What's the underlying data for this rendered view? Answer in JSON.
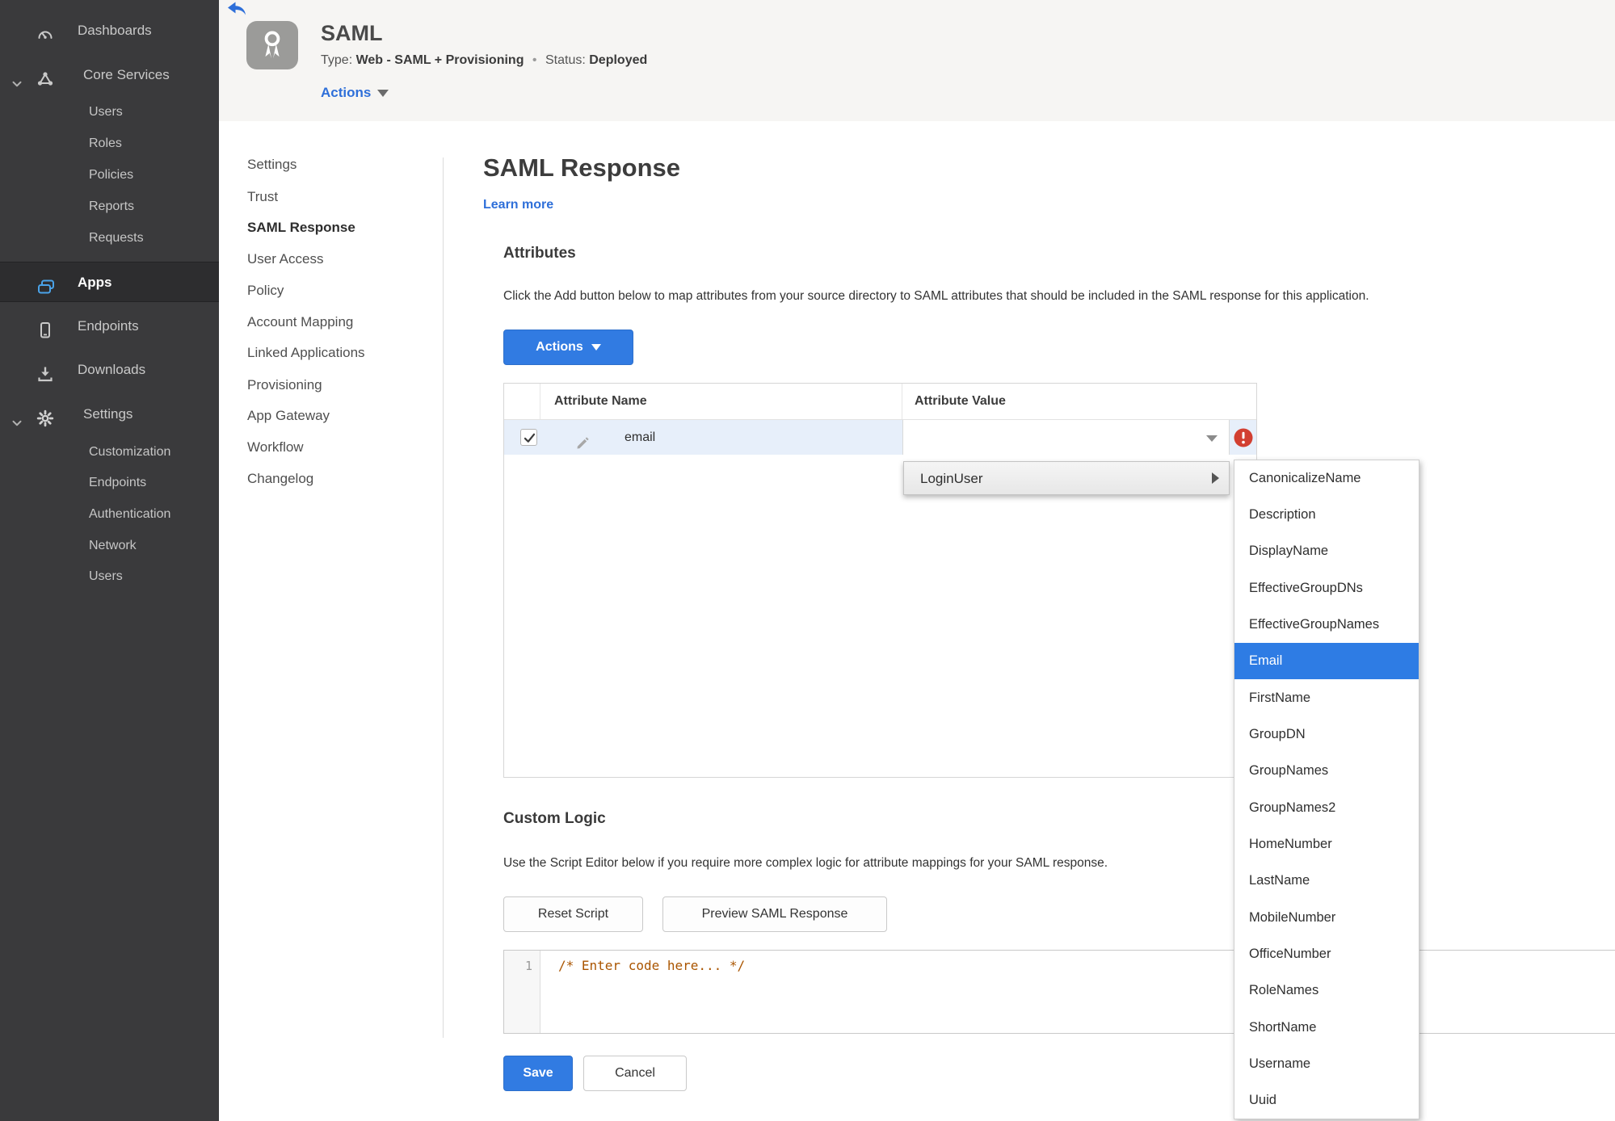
{
  "colors": {
    "accent_blue": "#317be2",
    "link_blue": "#2e6fd9",
    "status_green": "#4e8f20",
    "error_red": "#d23f31",
    "sidebar_bg": "#3a3a3c",
    "highlight_blue": "#2e7ce4",
    "apps_icon_blue": "#4aa3e9"
  },
  "sidebar": {
    "items": [
      {
        "label": "Dashboards",
        "icon": "dashboard-icon"
      },
      {
        "label": "Core Services",
        "icon": "core-services-icon",
        "expanded": true
      },
      {
        "label": "Users"
      },
      {
        "label": "Roles"
      },
      {
        "label": "Policies"
      },
      {
        "label": "Reports"
      },
      {
        "label": "Requests"
      },
      {
        "label": "Apps",
        "icon": "apps-icon",
        "active": true
      },
      {
        "label": "Endpoints",
        "icon": "endpoints-icon"
      },
      {
        "label": "Downloads",
        "icon": "downloads-icon"
      },
      {
        "label": "Settings",
        "icon": "settings-icon",
        "expanded": true
      },
      {
        "label": "Customization"
      },
      {
        "label": "Endpoints"
      },
      {
        "label": "Authentication"
      },
      {
        "label": "Network"
      },
      {
        "label": "Users"
      }
    ]
  },
  "header": {
    "app_title": "SAML",
    "type_label": "Type:",
    "type_value": "Web - SAML + Provisioning",
    "separator": "•",
    "status_label": "Status:",
    "status_value": "Deployed",
    "actions_label": "Actions"
  },
  "subnav": {
    "items": [
      "Settings",
      "Trust",
      "SAML Response",
      "User Access",
      "Policy",
      "Account Mapping",
      "Linked Applications",
      "Provisioning",
      "App Gateway",
      "Workflow",
      "Changelog"
    ],
    "active": "SAML Response"
  },
  "main": {
    "title": "SAML Response",
    "learn_more": "Learn more",
    "attributes": {
      "heading": "Attributes",
      "description": "Click the Add button below to map attributes from your source directory to SAML attributes that should be included in the SAML response for this application.",
      "actions_button": "Actions",
      "table": {
        "columns": [
          "Attribute Name",
          "Attribute Value"
        ],
        "rows": [
          {
            "name": "email",
            "value": "",
            "checked": true,
            "error": true
          }
        ]
      }
    },
    "dropdown": {
      "label": "LoginUser",
      "selected": "Email",
      "submenu": [
        "CanonicalizeName",
        "Description",
        "DisplayName",
        "EffectiveGroupDNs",
        "EffectiveGroupNames",
        "Email",
        "FirstName",
        "GroupDN",
        "GroupNames",
        "GroupNames2",
        "HomeNumber",
        "LastName",
        "MobileNumber",
        "OfficeNumber",
        "RoleNames",
        "ShortName",
        "Username",
        "Uuid"
      ]
    },
    "custom_logic": {
      "heading": "Custom Logic",
      "description": "Use the Script Editor below if you require more complex logic for attribute mappings for your SAML response.",
      "reset_button": "Reset Script",
      "preview_button": "Preview SAML Response",
      "editor": {
        "line_number": "1",
        "code": "/* Enter code here... */"
      }
    },
    "footer": {
      "save_button": "Save",
      "cancel_button": "Cancel"
    }
  }
}
